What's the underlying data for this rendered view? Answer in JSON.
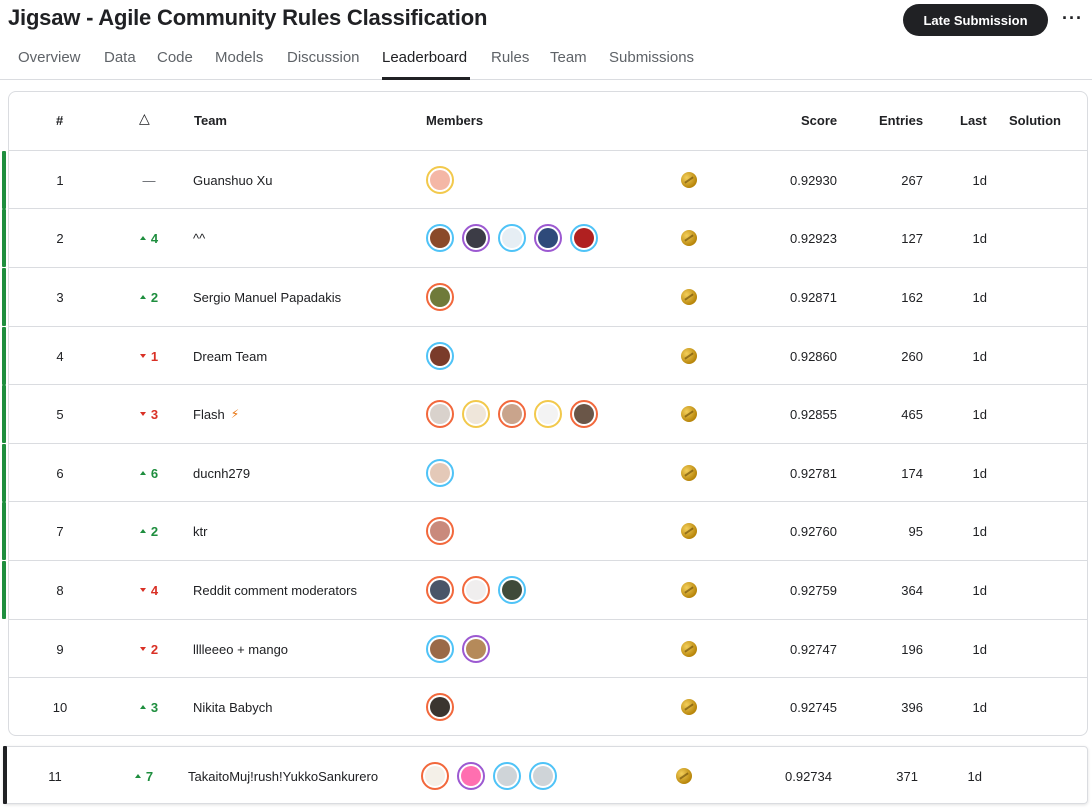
{
  "header": {
    "title": "Jigsaw - Agile Community Rules Classification",
    "late_submission_label": "Late Submission",
    "more_label": "···"
  },
  "tabs": [
    {
      "label": "Overview"
    },
    {
      "label": "Data"
    },
    {
      "label": "Code"
    },
    {
      "label": "Models"
    },
    {
      "label": "Discussion"
    },
    {
      "label": "Leaderboard",
      "active": true
    },
    {
      "label": "Rules"
    },
    {
      "label": "Team"
    },
    {
      "label": "Submissions"
    }
  ],
  "columns": {
    "rank": "#",
    "delta": "△",
    "team": "Team",
    "members": "Members",
    "score": "Score",
    "entries": "Entries",
    "last": "Last",
    "solution": "Solution"
  },
  "colors": {
    "accent_green": "#1e8e3e",
    "delta_down": "#d93025",
    "medal_gold": "#d4a017",
    "primary_dark": "#202124"
  },
  "rows": [
    {
      "rank": "1",
      "delta": "—",
      "direction": "same",
      "team": "Guanshuo Xu",
      "avatars": [
        {
          "ring": "#f2c94c",
          "fill": "#f4b7a6"
        }
      ],
      "score": "0.92930",
      "entries": "267",
      "last": "1d"
    },
    {
      "rank": "2",
      "delta": "4",
      "direction": "up",
      "team": "^^",
      "avatars": [
        {
          "ring": "#4fc3f7",
          "fill": "#8a4a2a"
        },
        {
          "ring": "#9c59d1",
          "fill": "#3c3c46"
        },
        {
          "ring": "#4fc3f7",
          "fill": "#e6eef4"
        },
        {
          "ring": "#9c59d1",
          "fill": "#2e4a7a"
        },
        {
          "ring": "#4fc3f7",
          "fill": "#b02020"
        }
      ],
      "score": "0.92923",
      "entries": "127",
      "last": "1d"
    },
    {
      "rank": "3",
      "delta": "2",
      "direction": "up",
      "team": "Sergio Manuel Papadakis",
      "avatars": [
        {
          "ring": "#f2683c",
          "fill": "#6f7a3a"
        }
      ],
      "score": "0.92871",
      "entries": "162",
      "last": "1d"
    },
    {
      "rank": "4",
      "delta": "1",
      "direction": "down",
      "team": "Dream Team",
      "avatars": [
        {
          "ring": "#4fc3f7",
          "fill": "#7a3b2a"
        }
      ],
      "score": "0.92860",
      "entries": "260",
      "last": "1d"
    },
    {
      "rank": "5",
      "delta": "3",
      "direction": "down",
      "team": "Flash",
      "bolt": true,
      "avatars": [
        {
          "ring": "#f2683c",
          "fill": "#d9d2cc"
        },
        {
          "ring": "#f2c94c",
          "fill": "#efe6da"
        },
        {
          "ring": "#f2683c",
          "fill": "#c9a48c"
        },
        {
          "ring": "#f2c94c",
          "fill": "#f3f3f3"
        },
        {
          "ring": "#f2683c",
          "fill": "#6a5648"
        }
      ],
      "score": "0.92855",
      "entries": "465",
      "last": "1d"
    },
    {
      "rank": "6",
      "delta": "6",
      "direction": "up",
      "team": "ducnh279",
      "avatars": [
        {
          "ring": "#4fc3f7",
          "fill": "#e4c9b8"
        }
      ],
      "score": "0.92781",
      "entries": "174",
      "last": "1d"
    },
    {
      "rank": "7",
      "delta": "2",
      "direction": "up",
      "team": "ktr",
      "avatars": [
        {
          "ring": "#f2683c",
          "fill": "#c98a7c"
        }
      ],
      "score": "0.92760",
      "entries": "95",
      "last": "1d"
    },
    {
      "rank": "8",
      "delta": "4",
      "direction": "down",
      "team": "Reddit comment moderators",
      "avatars": [
        {
          "ring": "#f2683c",
          "fill": "#4a5568"
        },
        {
          "ring": "#f2683c",
          "fill": "#f0eeee"
        },
        {
          "ring": "#4fc3f7",
          "fill": "#3f4a3a"
        }
      ],
      "score": "0.92759",
      "entries": "364",
      "last": "1d"
    },
    {
      "rank": "9",
      "delta": "2",
      "direction": "down",
      "team": "lllleeeo + mango",
      "avatars": [
        {
          "ring": "#4fc3f7",
          "fill": "#9a6a48"
        },
        {
          "ring": "#9c59d1",
          "fill": "#b58a5a"
        }
      ],
      "score": "0.92747",
      "entries": "196",
      "last": "1d"
    },
    {
      "rank": "10",
      "delta": "3",
      "direction": "up",
      "team": "Nikita Babych",
      "avatars": [
        {
          "ring": "#f2683c",
          "fill": "#3a3530"
        }
      ],
      "score": "0.92745",
      "entries": "396",
      "last": "1d"
    }
  ],
  "my_row": {
    "rank": "11",
    "delta": "7",
    "direction": "up",
    "team": "TakaitoMuj!rush!YukkoSankurero",
    "avatars": [
      {
        "ring": "#f2683c",
        "fill": "#f4f0e8"
      },
      {
        "ring": "#9c59d1",
        "fill": "#ff6fb0"
      },
      {
        "ring": "#4fc3f7",
        "fill": "#cfd4d8"
      },
      {
        "ring": "#4fc3f7",
        "fill": "#cfd4d8"
      }
    ],
    "score": "0.92734",
    "entries": "371",
    "last": "1d"
  }
}
